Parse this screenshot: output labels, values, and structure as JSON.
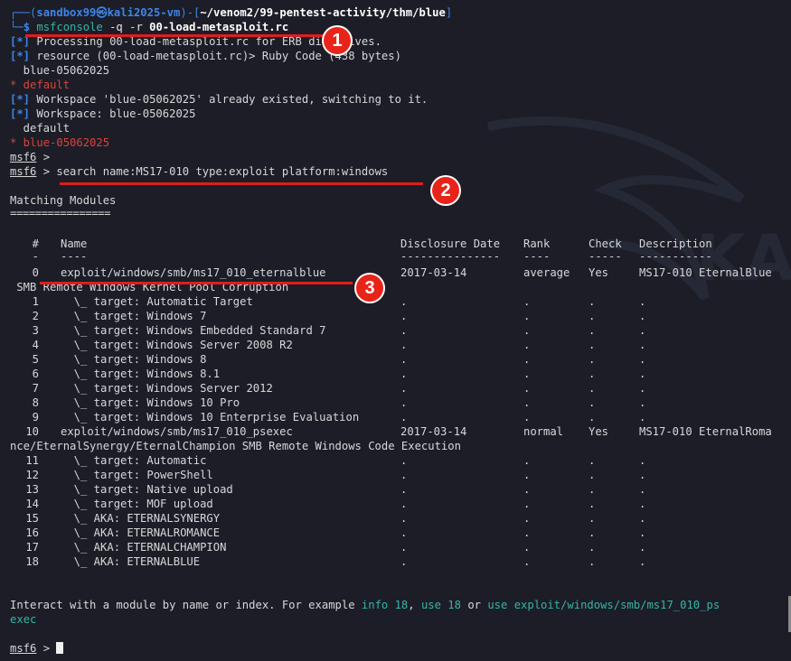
{
  "prompt": {
    "user": "sandbox99",
    "host": "kali2025-vm",
    "path": "~/venom2/99-pentest-activity/thm/blue",
    "command": "msfconsole",
    "args": "-q -r",
    "rc_file": "00-load-metasploit.rc"
  },
  "output_lines": [
    {
      "tag": "[*]",
      "text": " Processing 00-load-metasploit.rc for ERB directives."
    },
    {
      "tag": "[*]",
      "text": " resource (00-load-metasploit.rc)> Ruby Code (438 bytes)"
    },
    {
      "tag": "",
      "text": "  blue-05062025"
    },
    {
      "tag": "*",
      "text": " default",
      "red": true
    },
    {
      "tag": "[*]",
      "text": " Workspace 'blue-05062025' already existed, switching to it."
    },
    {
      "tag": "[*]",
      "text": " Workspace: blue-05062025"
    },
    {
      "tag": "",
      "text": "  default"
    },
    {
      "tag": "*",
      "text": " blue-05062025",
      "red": true
    }
  ],
  "msf_prompt": "msf6",
  "search_command": "search name:MS17-010 type:exploit platform:windows",
  "matching_title": "Matching Modules",
  "matching_underline": "================",
  "table": {
    "headers": [
      "#",
      "Name",
      "Disclosure Date",
      "Rank",
      "Check",
      "Description"
    ],
    "header_rules": [
      "-",
      "----",
      "---------------",
      "----",
      "-----",
      "-----------"
    ],
    "rows": [
      {
        "idx": "0",
        "name": "exploit/windows/smb/ms17_010_eternalblue",
        "date": "2017-03-14",
        "rank": "average",
        "check": "Yes",
        "desc": "MS17-010 EternalBlue"
      },
      {
        "idx": "",
        "wrap": " SMB Remote Windows Kernel Pool Corruption"
      },
      {
        "idx": "1",
        "name": "  \\_ target: Automatic Target",
        "date": ".",
        "rank": ".",
        "check": ".",
        "desc": "."
      },
      {
        "idx": "2",
        "name": "  \\_ target: Windows 7",
        "date": ".",
        "rank": ".",
        "check": ".",
        "desc": "."
      },
      {
        "idx": "3",
        "name": "  \\_ target: Windows Embedded Standard 7",
        "date": ".",
        "rank": ".",
        "check": ".",
        "desc": "."
      },
      {
        "idx": "4",
        "name": "  \\_ target: Windows Server 2008 R2",
        "date": ".",
        "rank": ".",
        "check": ".",
        "desc": "."
      },
      {
        "idx": "5",
        "name": "  \\_ target: Windows 8",
        "date": ".",
        "rank": ".",
        "check": ".",
        "desc": "."
      },
      {
        "idx": "6",
        "name": "  \\_ target: Windows 8.1",
        "date": ".",
        "rank": ".",
        "check": ".",
        "desc": "."
      },
      {
        "idx": "7",
        "name": "  \\_ target: Windows Server 2012",
        "date": ".",
        "rank": ".",
        "check": ".",
        "desc": "."
      },
      {
        "idx": "8",
        "name": "  \\_ target: Windows 10 Pro",
        "date": ".",
        "rank": ".",
        "check": ".",
        "desc": "."
      },
      {
        "idx": "9",
        "name": "  \\_ target: Windows 10 Enterprise Evaluation",
        "date": ".",
        "rank": ".",
        "check": ".",
        "desc": "."
      },
      {
        "idx": "10",
        "name": "exploit/windows/smb/ms17_010_psexec",
        "date": "2017-03-14",
        "rank": "normal",
        "check": "Yes",
        "desc": "MS17-010 EternalRoma"
      },
      {
        "idx": "",
        "wrap": "nce/EternalSynergy/EternalChampion SMB Remote Windows Code Execution"
      },
      {
        "idx": "11",
        "name": "  \\_ target: Automatic",
        "date": ".",
        "rank": ".",
        "check": ".",
        "desc": "."
      },
      {
        "idx": "12",
        "name": "  \\_ target: PowerShell",
        "date": ".",
        "rank": ".",
        "check": ".",
        "desc": "."
      },
      {
        "idx": "13",
        "name": "  \\_ target: Native upload",
        "date": ".",
        "rank": ".",
        "check": ".",
        "desc": "."
      },
      {
        "idx": "14",
        "name": "  \\_ target: MOF upload",
        "date": ".",
        "rank": ".",
        "check": ".",
        "desc": "."
      },
      {
        "idx": "15",
        "name": "  \\_ AKA: ETERNALSYNERGY",
        "date": ".",
        "rank": ".",
        "check": ".",
        "desc": "."
      },
      {
        "idx": "16",
        "name": "  \\_ AKA: ETERNALROMANCE",
        "date": ".",
        "rank": ".",
        "check": ".",
        "desc": "."
      },
      {
        "idx": "17",
        "name": "  \\_ AKA: ETERNALCHAMPION",
        "date": ".",
        "rank": ".",
        "check": ".",
        "desc": "."
      },
      {
        "idx": "18",
        "name": "  \\_ AKA: ETERNALBLUE",
        "date": ".",
        "rank": ".",
        "check": ".",
        "desc": "."
      }
    ]
  },
  "interact": {
    "pre": "Interact with a module by name or index. For example ",
    "hint1": "info 18",
    "sep1": ", ",
    "hint2": "use 18",
    "sep2": " or ",
    "hint3": "use exploit/windows/smb/ms17_010_ps",
    "hint3b": "exec"
  },
  "badges": [
    "1",
    "2",
    "3"
  ],
  "colors": {
    "prompt_blue": "#3d86e8",
    "error_red": "#d7453c",
    "hint_teal": "#35b5a6",
    "annotation_red": "#e8231a"
  }
}
